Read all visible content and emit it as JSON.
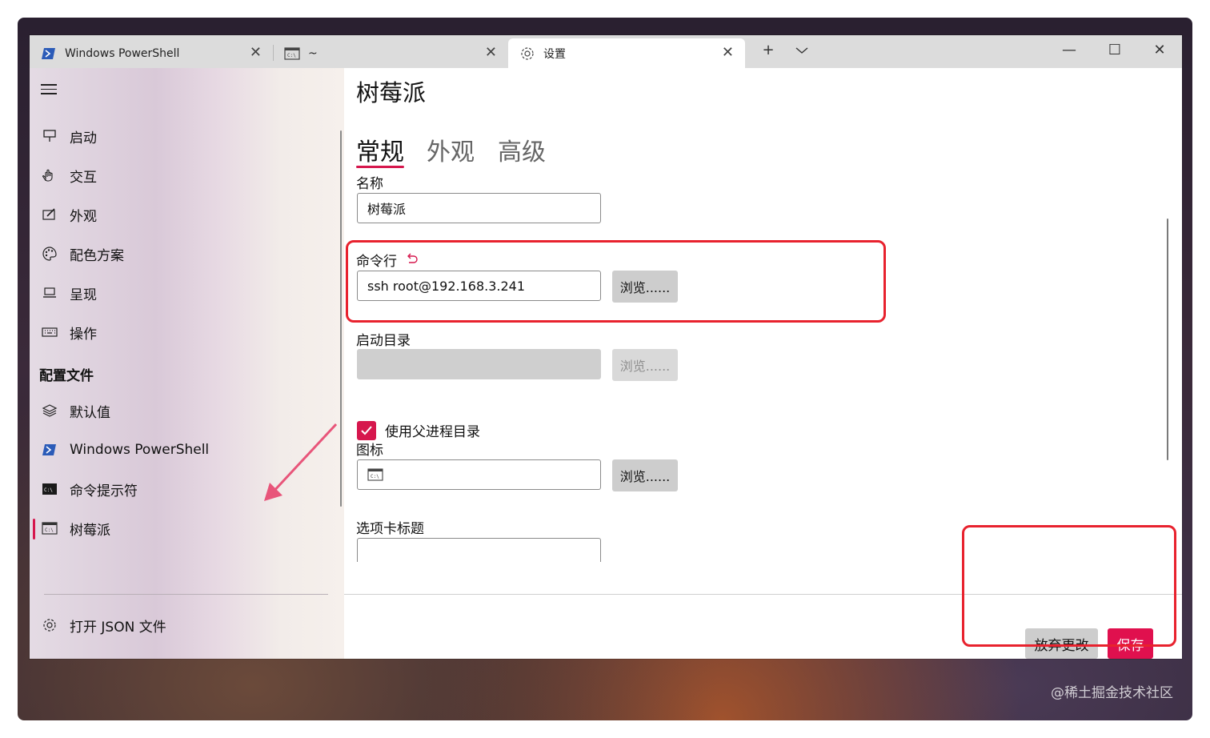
{
  "tabs": [
    {
      "label": "Windows PowerShell",
      "icon": "powershell-icon"
    },
    {
      "label": "~",
      "icon": "cmd-icon"
    },
    {
      "label": "设置",
      "icon": "gear-icon"
    }
  ],
  "window_controls": {
    "new_tab": "+",
    "dropdown": "⌵",
    "minimize": "—",
    "maximize": "☐",
    "close": "✕"
  },
  "sidebar": {
    "items": [
      {
        "label": "启动",
        "icon": "startup-icon"
      },
      {
        "label": "交互",
        "icon": "interaction-icon"
      },
      {
        "label": "外观",
        "icon": "appearance-icon"
      },
      {
        "label": "配色方案",
        "icon": "palette-icon"
      },
      {
        "label": "呈现",
        "icon": "rendering-icon"
      },
      {
        "label": "操作",
        "icon": "keyboard-icon"
      }
    ],
    "profiles_header": "配置文件",
    "profiles": [
      {
        "label": "默认值",
        "icon": "layers-icon"
      },
      {
        "label": "Windows PowerShell",
        "icon": "powershell-icon"
      },
      {
        "label": "命令提示符",
        "icon": "cmd-icon"
      },
      {
        "label": "树莓派",
        "icon": "terminal-icon"
      }
    ],
    "open_json": "打开 JSON 文件"
  },
  "main": {
    "title": "树莓派",
    "pivots": [
      "常规",
      "外观",
      "高级"
    ],
    "name_label": "名称",
    "name_value": "树莓派",
    "commandline_label": "命令行",
    "commandline_value": "ssh root@192.168.3.241",
    "browse": "浏览......",
    "startdir_label": "启动目录",
    "startdir_value": "",
    "use_parent_label": "使用父进程目录",
    "use_parent_checked": true,
    "icon_label": "图标",
    "tab_title_label": "选项卡标题",
    "discard": "放弃更改",
    "save": "保存"
  },
  "watermark": "@稀土掘金技术社区",
  "colors": {
    "accent": "#d6174d",
    "save_button": "#e0104e",
    "annotation": "#e8222e"
  }
}
